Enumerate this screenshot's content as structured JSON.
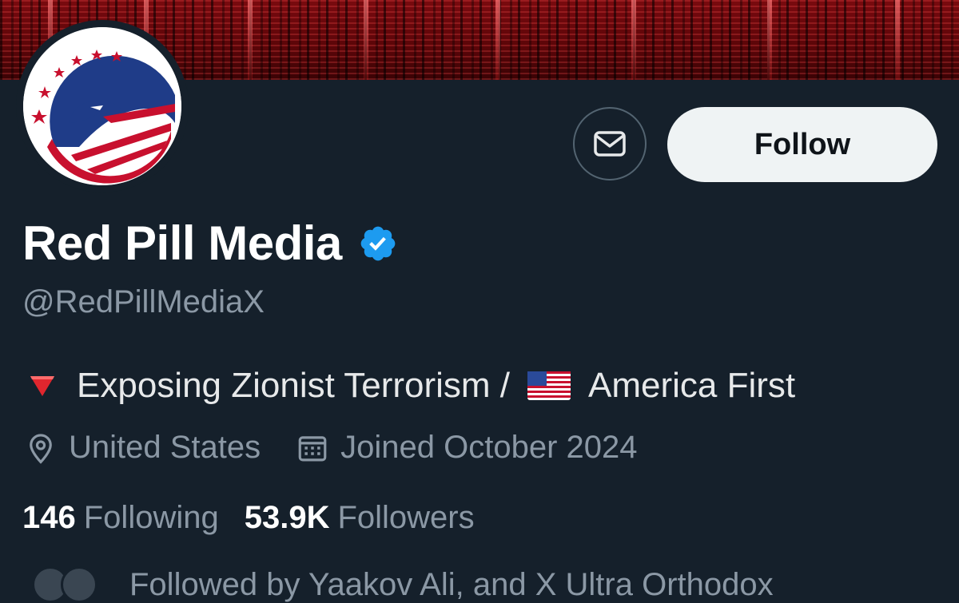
{
  "profile": {
    "display_name": "Red Pill Media",
    "handle": "@RedPillMediaX",
    "verified": true,
    "bio": {
      "text_1": "Exposing Zionist Terrorism /",
      "text_2": "America First"
    },
    "location": "United States",
    "joined": "Joined October 2024",
    "following_count": "146",
    "following_label": "Following",
    "followers_count": "53.9K",
    "followers_label": "Followers",
    "followed_by": "Followed by Yaakov Ali, and X Ultra Orthodox"
  },
  "actions": {
    "follow_label": "Follow",
    "message_icon": "mail-icon"
  },
  "colors": {
    "background": "#15202b",
    "verified": "#1d9bf0",
    "secondary_text": "#8b98a5",
    "follow_button": "#eff3f4"
  }
}
